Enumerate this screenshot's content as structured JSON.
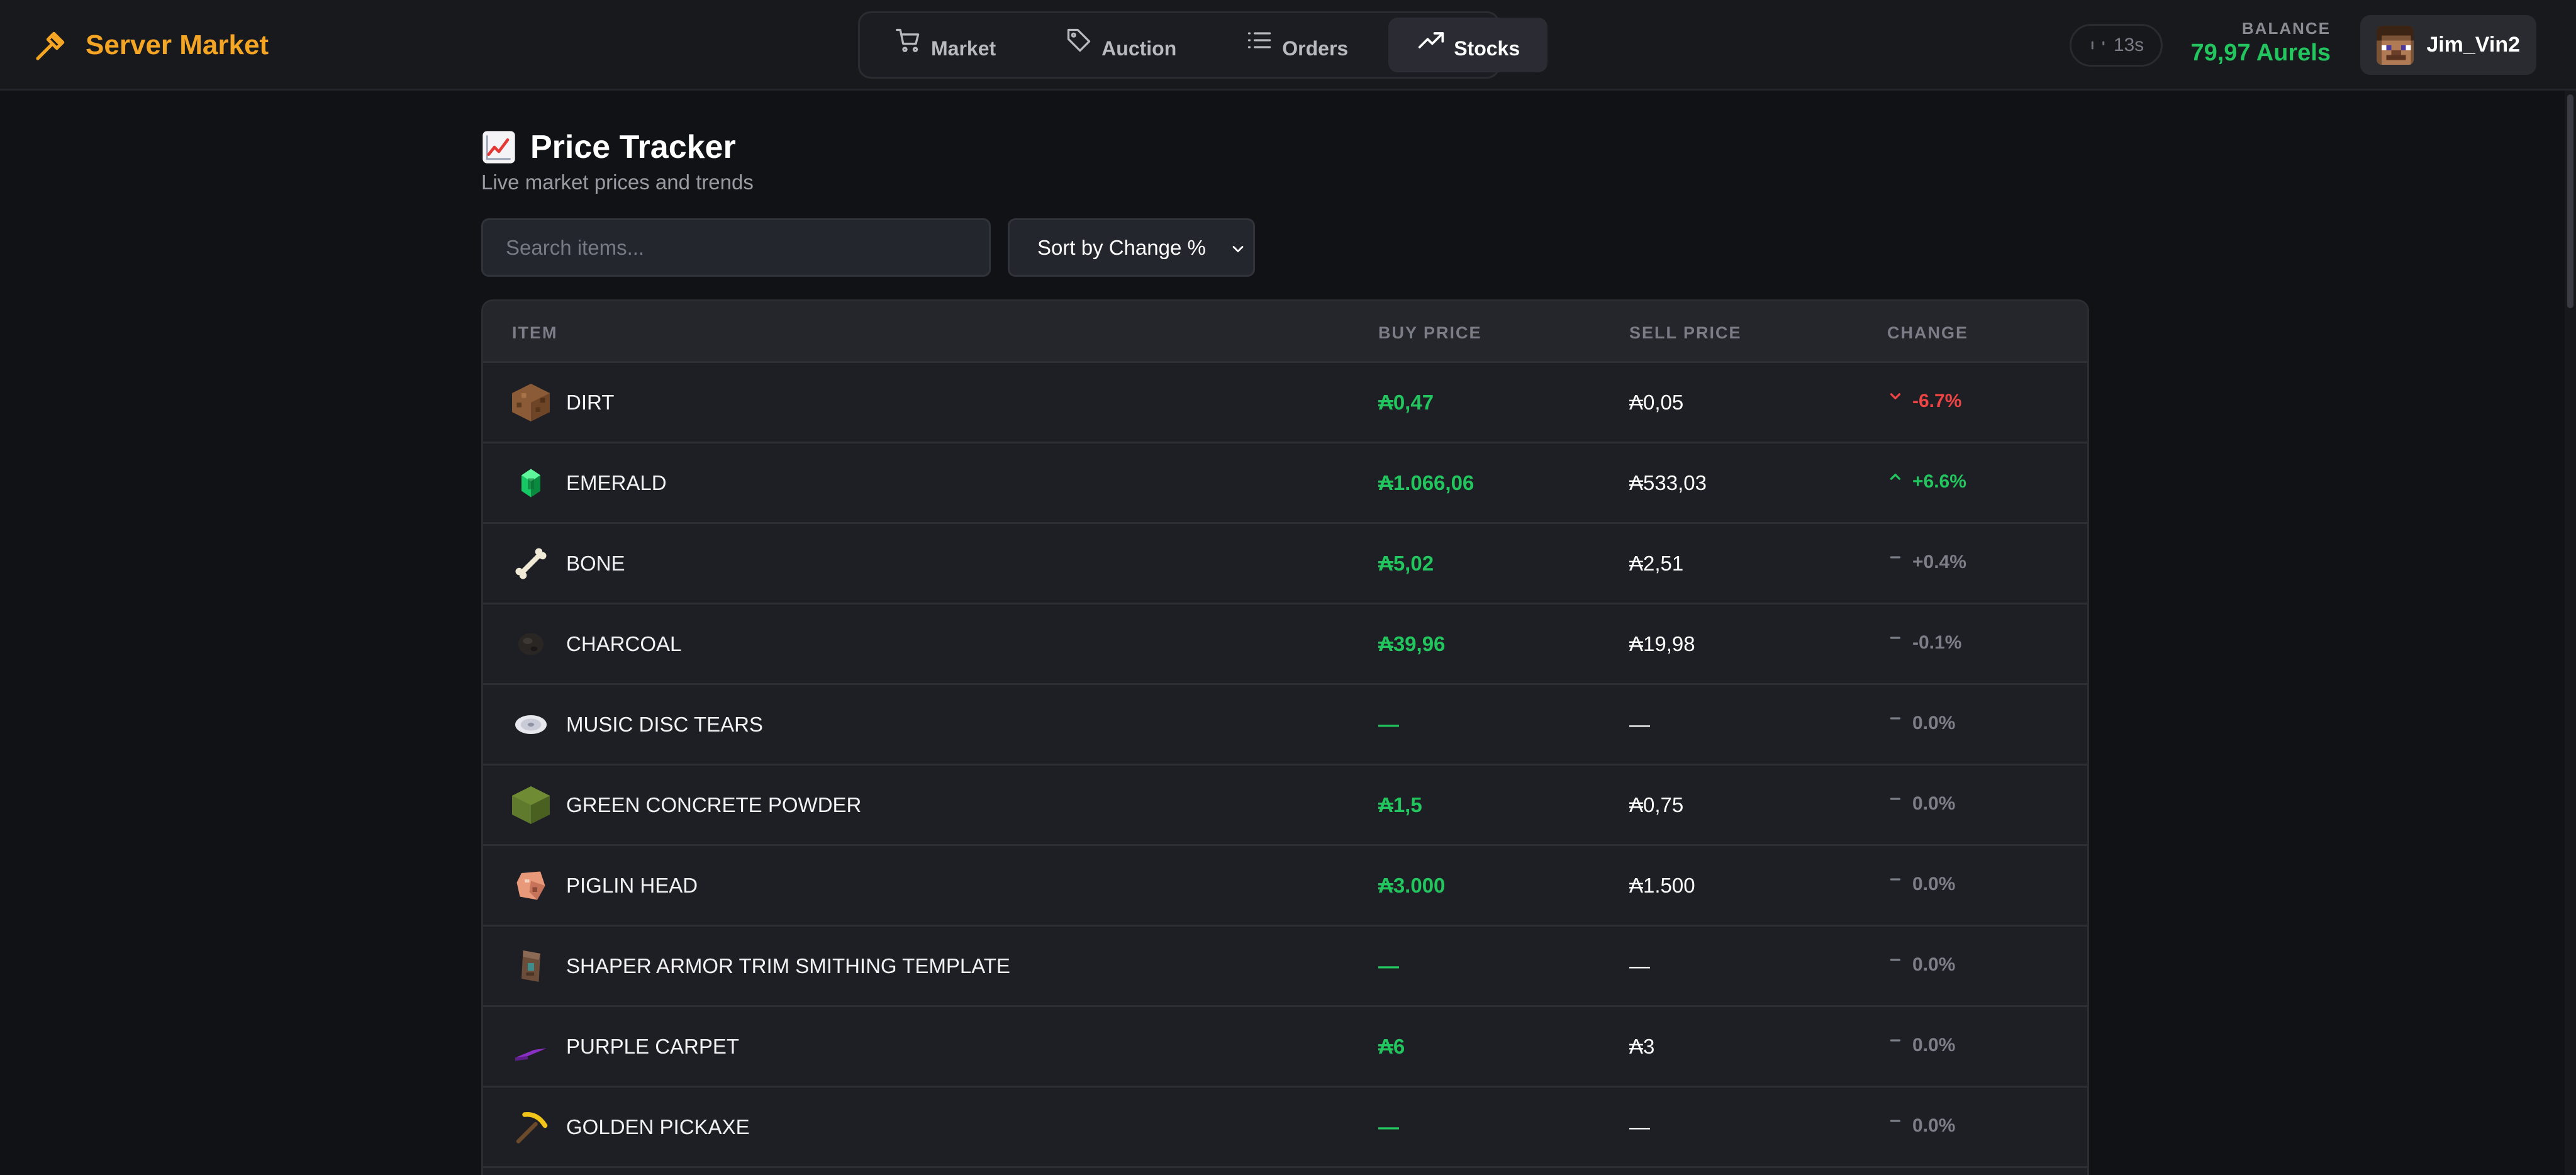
{
  "header": {
    "brand": "Server Market",
    "nav": [
      {
        "label": "Market",
        "icon": "cart-icon"
      },
      {
        "label": "Auction",
        "icon": "tag-icon"
      },
      {
        "label": "Orders",
        "icon": "list-icon"
      },
      {
        "label": "Stocks",
        "icon": "trending-up-icon",
        "active": true
      }
    ],
    "refresh_timer": "13s",
    "balance_label": "BALANCE",
    "balance_value": "79,97 Aurels",
    "user_name": "Jim_Vin2"
  },
  "page": {
    "title": "Price Tracker",
    "subtitle": "Live market prices and trends",
    "search_placeholder": "Search items...",
    "sort_label": "Sort by Change %"
  },
  "table": {
    "headers": {
      "item": "ITEM",
      "buy": "BUY PRICE",
      "sell": "SELL PRICE",
      "change": "CHANGE"
    },
    "rows": [
      {
        "name": "DIRT",
        "buy": "₳0,47",
        "sell": "₳0,05",
        "change": "-6.7%",
        "trend": "down",
        "icon": "dirt-icon"
      },
      {
        "name": "EMERALD",
        "buy": "₳1.066,06",
        "sell": "₳533,03",
        "change": "+6.6%",
        "trend": "up",
        "icon": "emerald-icon"
      },
      {
        "name": "BONE",
        "buy": "₳5,02",
        "sell": "₳2,51",
        "change": "+0.4%",
        "trend": "flat",
        "icon": "bone-icon"
      },
      {
        "name": "CHARCOAL",
        "buy": "₳39,96",
        "sell": "₳19,98",
        "change": "-0.1%",
        "trend": "flat",
        "icon": "charcoal-icon"
      },
      {
        "name": "MUSIC DISC TEARS",
        "buy": "—",
        "sell": "—",
        "change": "0.0%",
        "trend": "flat",
        "icon": "music-disc-icon"
      },
      {
        "name": "GREEN CONCRETE POWDER",
        "buy": "₳1,5",
        "sell": "₳0,75",
        "change": "0.0%",
        "trend": "flat",
        "icon": "concrete-powder-icon"
      },
      {
        "name": "PIGLIN HEAD",
        "buy": "₳3.000",
        "sell": "₳1.500",
        "change": "0.0%",
        "trend": "flat",
        "icon": "piglin-head-icon"
      },
      {
        "name": "SHAPER ARMOR TRIM SMITHING TEMPLATE",
        "buy": "—",
        "sell": "—",
        "change": "0.0%",
        "trend": "flat",
        "icon": "smithing-template-icon"
      },
      {
        "name": "PURPLE CARPET",
        "buy": "₳6",
        "sell": "₳3",
        "change": "0.0%",
        "trend": "flat",
        "icon": "carpet-icon"
      },
      {
        "name": "GOLDEN PICKAXE",
        "buy": "—",
        "sell": "—",
        "change": "0.0%",
        "trend": "flat",
        "icon": "pickaxe-icon"
      }
    ]
  },
  "colors": {
    "accent": "#f5a524",
    "positive": "#22c55e",
    "negative": "#ef4444",
    "neutral": "#7d7f88",
    "background": "#111216"
  }
}
